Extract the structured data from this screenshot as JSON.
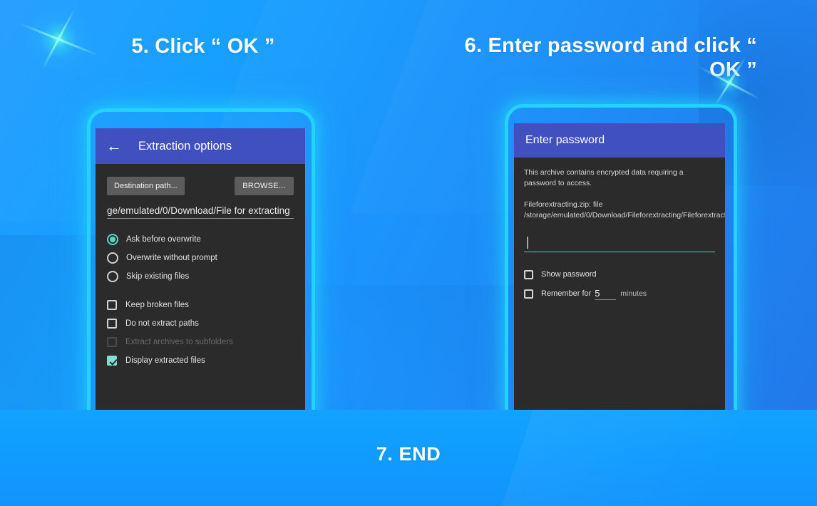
{
  "headings": {
    "step5": "5. Click “ OK ”",
    "step6": "6. Enter password and click “ OK ”",
    "step7": "7. END"
  },
  "colors": {
    "background_blue": "#18a0ff",
    "phone_glow": "#22d3ff",
    "appbar_indigo": "#4050bf",
    "screen_dark": "#2b2b2b",
    "accent_teal": "#57d7c2",
    "button_grey": "#5c5c5c",
    "heading_white": "#ffffff"
  },
  "left_phone": {
    "appbar": {
      "back_icon": "back-arrow-icon",
      "title": "Extraction options"
    },
    "buttons": {
      "destination": "Destination path...",
      "browse": "BROWSE..."
    },
    "path_value": "ge/emulated/0/Download/File for extracting",
    "overwrite_options": [
      {
        "label": "Ask before overwrite",
        "selected": true
      },
      {
        "label": "Overwrite without prompt",
        "selected": false
      },
      {
        "label": "Skip existing files",
        "selected": false
      }
    ],
    "checkboxes": [
      {
        "label": "Keep broken files",
        "checked": false,
        "disabled": false
      },
      {
        "label": "Do not extract paths",
        "checked": false,
        "disabled": false
      },
      {
        "label": "Extract archives to subfolders",
        "checked": false,
        "disabled": true
      },
      {
        "label": "Display extracted files",
        "checked": true,
        "disabled": false
      }
    ]
  },
  "right_phone": {
    "appbar": {
      "title": "Enter password"
    },
    "description": "This archive contains encrypted data requiring a password to access.",
    "archive_info": "Fileforextracting.zip: file /storage/emulated/0/Download/Fileforextracting/Fileforextracting/.DS_Store",
    "password_value": "",
    "checkboxes": [
      {
        "label": "Show password",
        "checked": false
      },
      {
        "label": "Remember for",
        "checked": false
      }
    ],
    "remember_minutes": "5",
    "remember_unit": "minutes"
  },
  "decor": {
    "sparkle_top_left": "sparkle-icon",
    "sparkle_top_right": "sparkle-icon"
  }
}
